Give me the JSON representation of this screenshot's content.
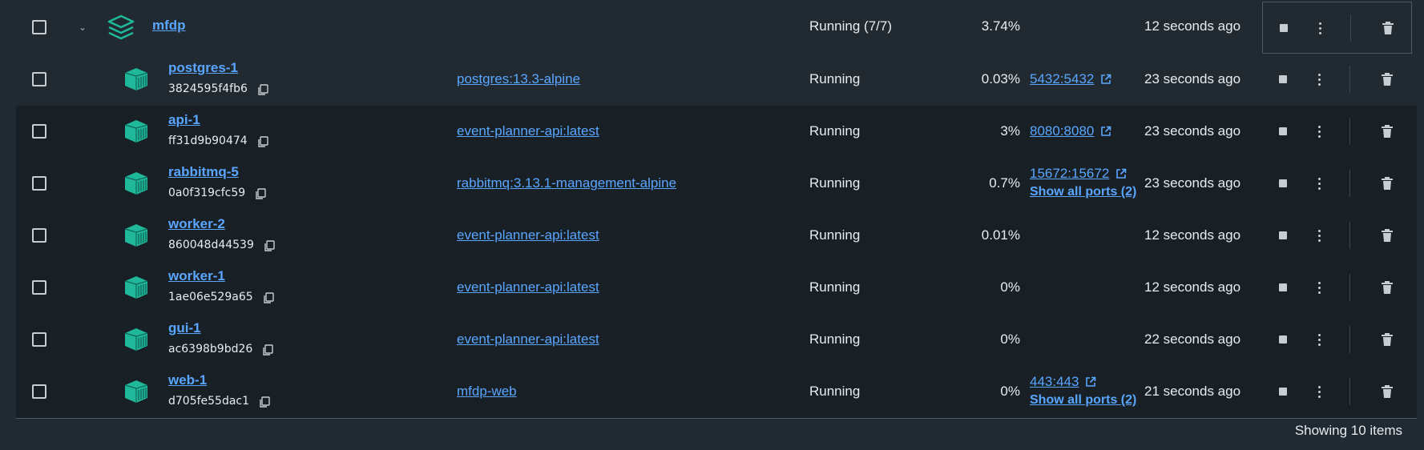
{
  "group": {
    "name": "mfdp",
    "status": "Running (7/7)",
    "cpu": "3.74%",
    "last_started": "12 seconds ago"
  },
  "containers": [
    {
      "name": "postgres-1",
      "id": "3824595f4fb6",
      "image": "postgres:13.3-alpine",
      "status": "Running",
      "cpu": "0.03%",
      "port": "5432:5432",
      "show_all_ports": "",
      "last_started": "23 seconds ago"
    },
    {
      "name": "api-1",
      "id": "ff31d9b90474",
      "image": "event-planner-api:latest",
      "status": "Running",
      "cpu": "3%",
      "port": "8080:8080",
      "show_all_ports": "",
      "last_started": "23 seconds ago"
    },
    {
      "name": "rabbitmq-5",
      "id": "0a0f319cfc59",
      "image": "rabbitmq:3.13.1-management-alpine",
      "status": "Running",
      "cpu": "0.7%",
      "port": "15672:15672",
      "show_all_ports": "Show all ports (2)",
      "last_started": "23 seconds ago"
    },
    {
      "name": "worker-2",
      "id": "860048d44539",
      "image": "event-planner-api:latest",
      "status": "Running",
      "cpu": "0.01%",
      "port": "",
      "show_all_ports": "",
      "last_started": "12 seconds ago"
    },
    {
      "name": "worker-1",
      "id": "1ae06e529a65",
      "image": "event-planner-api:latest",
      "status": "Running",
      "cpu": "0%",
      "port": "",
      "show_all_ports": "",
      "last_started": "12 seconds ago"
    },
    {
      "name": "gui-1",
      "id": "ac6398b9bd26",
      "image": "event-planner-api:latest",
      "status": "Running",
      "cpu": "0%",
      "port": "",
      "show_all_ports": "",
      "last_started": "22 seconds ago"
    },
    {
      "name": "web-1",
      "id": "d705fe55dac1",
      "image": "mfdp-web",
      "status": "Running",
      "cpu": "0%",
      "port": "443:443",
      "show_all_ports": "Show all ports (2)",
      "last_started": "21 seconds ago"
    }
  ],
  "footer": {
    "showing": "Showing 10 items"
  },
  "colors": {
    "link": "#5aa6ff",
    "icon_teal": "#1fb89a",
    "row_bg": "#182026",
    "row_bg_highlight": "#212a31"
  },
  "icons": {
    "group": "stack-layers-icon",
    "container": "container-box-icon",
    "copy": "copy-icon",
    "external": "external-link-icon",
    "stop": "stop-icon",
    "more": "kebab-icon",
    "delete": "trash-icon"
  }
}
